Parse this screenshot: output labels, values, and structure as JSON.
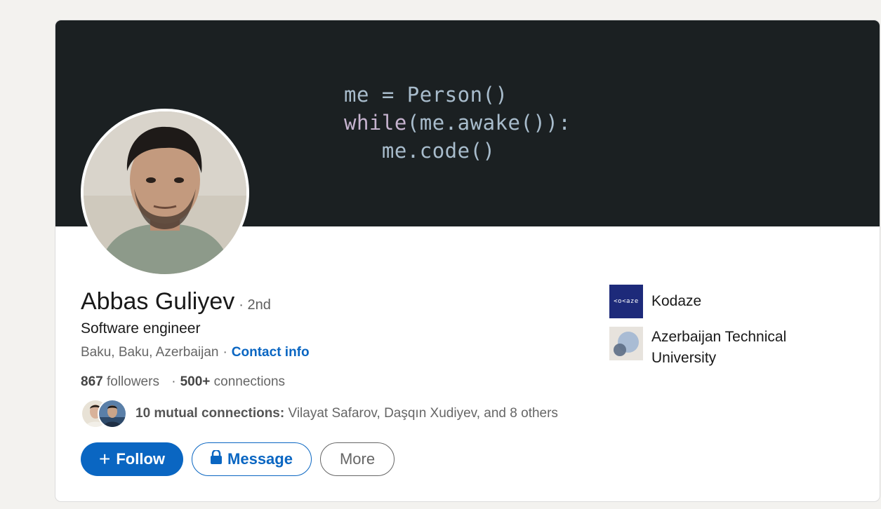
{
  "banner": {
    "code_lines": [
      {
        "parts": [
          {
            "text": "me = Person()",
            "cls": ""
          }
        ]
      },
      {
        "parts": [
          {
            "text": "while",
            "cls": "kw"
          },
          {
            "text": "(me.awake()):",
            "cls": ""
          }
        ]
      },
      {
        "parts": [
          {
            "text": "   me.code()",
            "cls": ""
          }
        ]
      }
    ]
  },
  "profile": {
    "name": "Abbas Guliyev",
    "degree": "· 2nd",
    "headline": "Software engineer",
    "location": "Baku, Baku, Azerbaijan",
    "separator": "·",
    "contact_info": "Contact info",
    "followers_count": "867",
    "followers_label": "followers",
    "connections_sep": "·",
    "connections_count": "500+",
    "connections_label": "connections",
    "mutual_bold": "10 mutual connections:",
    "mutual_rest": "Vilayat Safarov, Daşqın Xudiyev, and 8 others"
  },
  "actions": {
    "follow": "Follow",
    "message": "Message",
    "more": "More"
  },
  "experience": [
    {
      "name": "Kodaze",
      "logo_text": "<o<aze"
    },
    {
      "name": "Azerbaijan Technical University"
    }
  ],
  "colors": {
    "accent": "#0a66c2",
    "banner_bg": "#1b2022"
  }
}
